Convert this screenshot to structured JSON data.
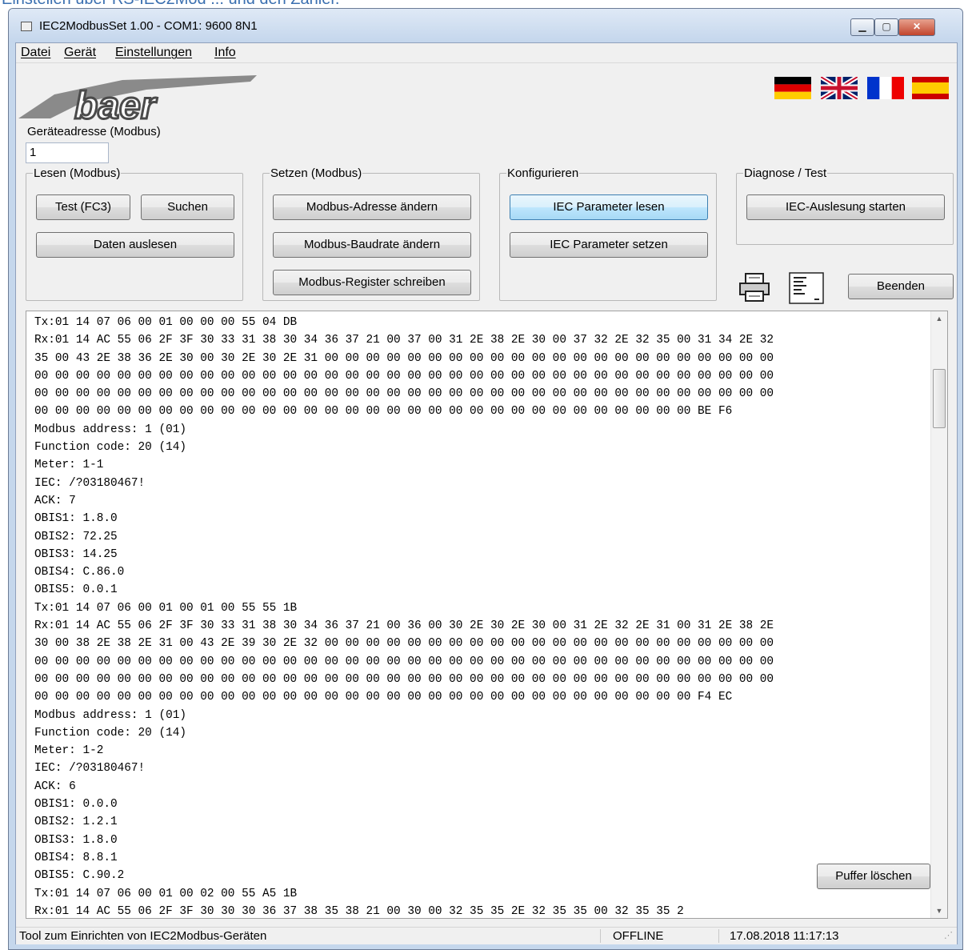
{
  "window": {
    "title": "IEC2ModbusSet 1.00 - COM1: 9600 8N1",
    "min_glyph": "▁",
    "max_glyph": "▢",
    "close_glyph": "✕"
  },
  "menu": [
    "Datei",
    "Gerät",
    "Einstellungen",
    "Info"
  ],
  "logo_text": "baer",
  "flags": [
    "german-flag",
    "uk-flag",
    "french-flag",
    "spanish-flag"
  ],
  "device_address": {
    "label": "Geräteadresse (Modbus)",
    "value": "1"
  },
  "groups": {
    "lesen": {
      "title": "Lesen (Modbus)",
      "test_label": "Test (FC3)",
      "suchen_label": "Suchen",
      "daten_label": "Daten auslesen"
    },
    "setzen": {
      "title": "Setzen (Modbus)",
      "adresse_label": "Modbus-Adresse ändern",
      "baudrate_label": "Modbus-Baudrate ändern",
      "register_label": "Modbus-Register schreiben"
    },
    "konfigurieren": {
      "title": "Konfigurieren",
      "lesen_label": "IEC Parameter lesen",
      "setzen_label": "IEC Parameter setzen"
    },
    "diagnose": {
      "title": "Diagnose / Test",
      "start_label": "IEC-Auslesung starten"
    }
  },
  "toolbar": {
    "print_icon": "printer-icon",
    "doc_icon": "document-icon",
    "beenden_label": "Beenden"
  },
  "log_lines": [
    "Tx:01 14 07 06 00 01 00 00 00 55 04 DB",
    "Rx:01 14 AC 55 06 2F 3F 30 33 31 38 30 34 36 37 21 00 37 00 31 2E 38 2E 30 00 37 32 2E 32 35 00 31 34 2E 32",
    "35 00 43 2E 38 36 2E 30 00 30 2E 30 2E 31 00 00 00 00 00 00 00 00 00 00 00 00 00 00 00 00 00 00 00 00 00 00",
    "00 00 00 00 00 00 00 00 00 00 00 00 00 00 00 00 00 00 00 00 00 00 00 00 00 00 00 00 00 00 00 00 00 00 00 00",
    "00 00 00 00 00 00 00 00 00 00 00 00 00 00 00 00 00 00 00 00 00 00 00 00 00 00 00 00 00 00 00 00 00 00 00 00",
    "00 00 00 00 00 00 00 00 00 00 00 00 00 00 00 00 00 00 00 00 00 00 00 00 00 00 00 00 00 00 00 00 BE F6",
    "Modbus address: 1 (01)",
    "Function code: 20 (14)",
    "Meter: 1-1",
    "IEC: /?03180467!",
    "ACK: 7",
    "OBIS1: 1.8.0",
    "OBIS2: 72.25",
    "OBIS3: 14.25",
    "OBIS4: C.86.0",
    "OBIS5: 0.0.1",
    "Tx:01 14 07 06 00 01 00 01 00 55 55 1B",
    "Rx:01 14 AC 55 06 2F 3F 30 33 31 38 30 34 36 37 21 00 36 00 30 2E 30 2E 30 00 31 2E 32 2E 31 00 31 2E 38 2E",
    "30 00 38 2E 38 2E 31 00 43 2E 39 30 2E 32 00 00 00 00 00 00 00 00 00 00 00 00 00 00 00 00 00 00 00 00 00 00",
    "00 00 00 00 00 00 00 00 00 00 00 00 00 00 00 00 00 00 00 00 00 00 00 00 00 00 00 00 00 00 00 00 00 00 00 00",
    "00 00 00 00 00 00 00 00 00 00 00 00 00 00 00 00 00 00 00 00 00 00 00 00 00 00 00 00 00 00 00 00 00 00 00 00",
    "00 00 00 00 00 00 00 00 00 00 00 00 00 00 00 00 00 00 00 00 00 00 00 00 00 00 00 00 00 00 00 00 F4 EC",
    "Modbus address: 1 (01)",
    "Function code: 20 (14)",
    "Meter: 1-2",
    "IEC: /?03180467!",
    "ACK: 6",
    "OBIS1: 0.0.0",
    "OBIS2: 1.2.1",
    "OBIS3: 1.8.0",
    "OBIS4: 8.8.1",
    "OBIS5: C.90.2",
    "Tx:01 14 07 06 00 01 00 02 00 55 A5 1B",
    "Rx:01 14 AC 55 06 2F 3F 30 30 30 36 37 38 35 38 21 00 30 00 32 35 35 2E 32 35 35 00 32 35 35 2"
  ],
  "puffer_label": "Puffer löschen",
  "status": {
    "message": "Tool zum Einrichten von IEC2Modbus-Geräten",
    "connection": "OFFLINE",
    "datetime": "17.08.2018 11:17:13"
  }
}
